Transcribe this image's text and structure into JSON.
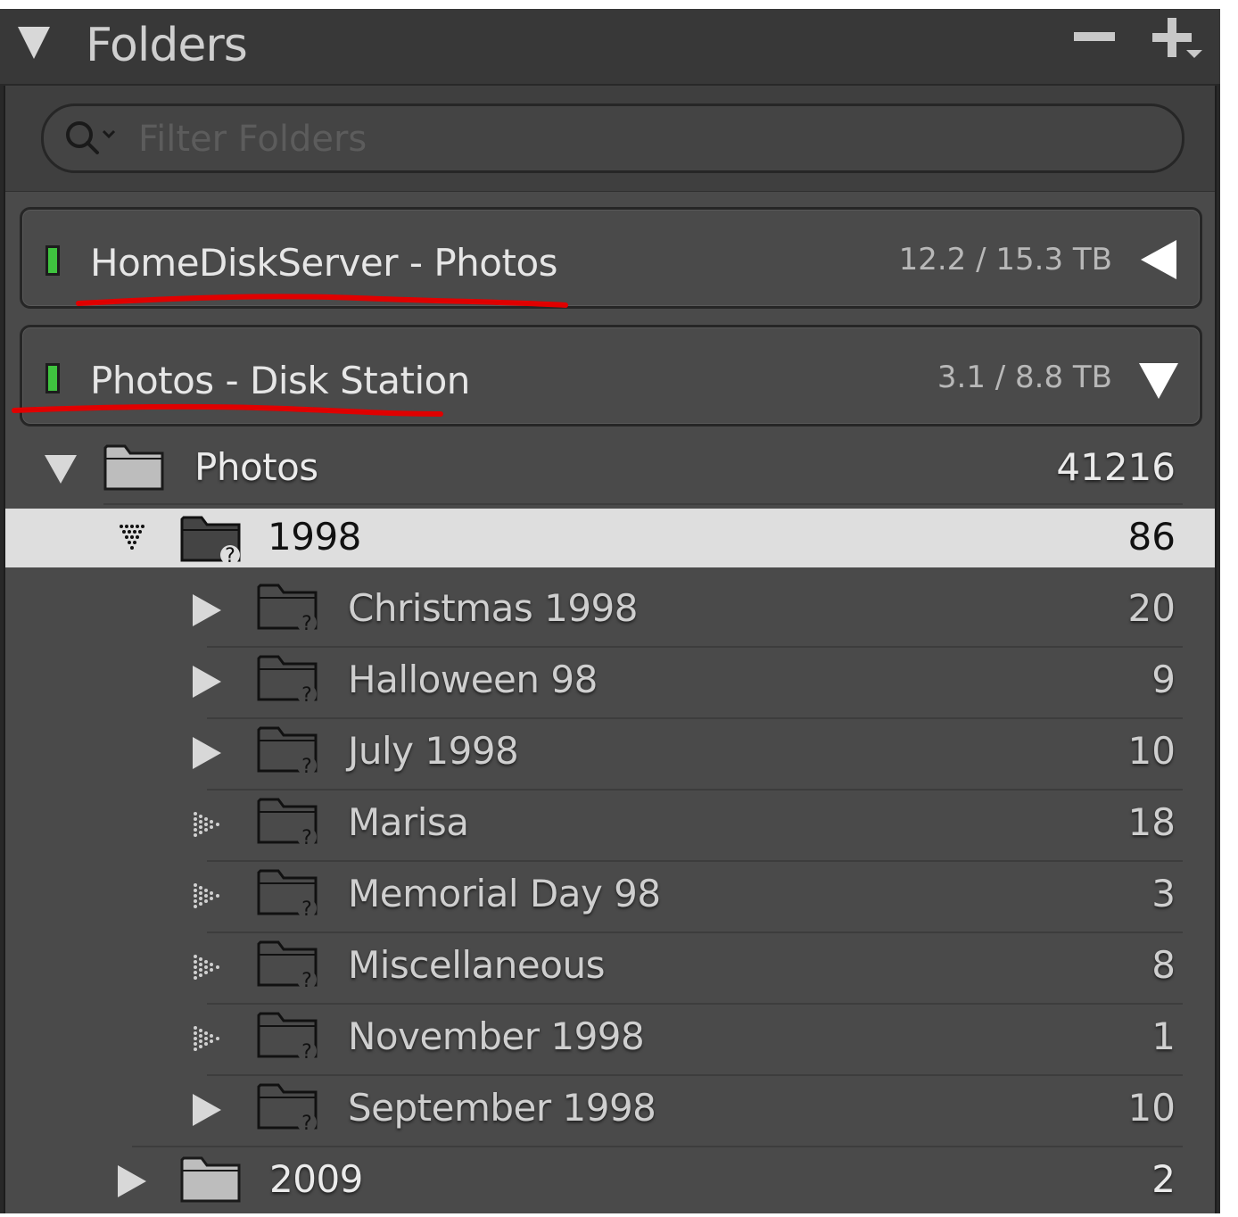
{
  "header": {
    "title": "Folders",
    "collapse_icon": "triangle-down-icon",
    "remove_icon": "minus-icon",
    "add_icon": "plus-icon"
  },
  "filter": {
    "placeholder": "Filter Folders",
    "value": "",
    "icon": "search-icon"
  },
  "volumes": [
    {
      "name": "HomeDiskServer - Photos",
      "size": "12.2 / 15.3 TB",
      "status_color": "#3fc43f",
      "state": "collapsed"
    },
    {
      "name": "Photos - Disk Station",
      "size": "3.1 / 8.8 TB",
      "status_color": "#3fc43f",
      "state": "expanded"
    }
  ],
  "annotations": {
    "underline_color": "#e00000"
  },
  "tree": [
    {
      "label": "Photos",
      "count": "41216",
      "expander": "expanded",
      "folder_state": "normal",
      "selected": false
    },
    {
      "label": "1998",
      "count": "86",
      "expander": "expanded",
      "folder_state": "missing",
      "selected": true
    },
    {
      "label": "Christmas 1998",
      "count": "20",
      "expander": "collapsed",
      "folder_state": "missing",
      "selected": false
    },
    {
      "label": "Halloween 98",
      "count": "9",
      "expander": "collapsed",
      "folder_state": "missing",
      "selected": false
    },
    {
      "label": "July 1998",
      "count": "10",
      "expander": "collapsed",
      "folder_state": "missing",
      "selected": false
    },
    {
      "label": "Marisa",
      "count": "18",
      "expander": "none",
      "folder_state": "missing",
      "selected": false
    },
    {
      "label": "Memorial Day 98",
      "count": "3",
      "expander": "none",
      "folder_state": "missing",
      "selected": false
    },
    {
      "label": "Miscellaneous",
      "count": "8",
      "expander": "none",
      "folder_state": "missing",
      "selected": false
    },
    {
      "label": "November 1998",
      "count": "1",
      "expander": "none",
      "folder_state": "missing",
      "selected": false
    },
    {
      "label": "September 1998",
      "count": "10",
      "expander": "collapsed",
      "folder_state": "missing",
      "selected": false
    },
    {
      "label": "2009",
      "count": "2",
      "expander": "collapsed",
      "folder_state": "normal",
      "selected": false
    }
  ]
}
